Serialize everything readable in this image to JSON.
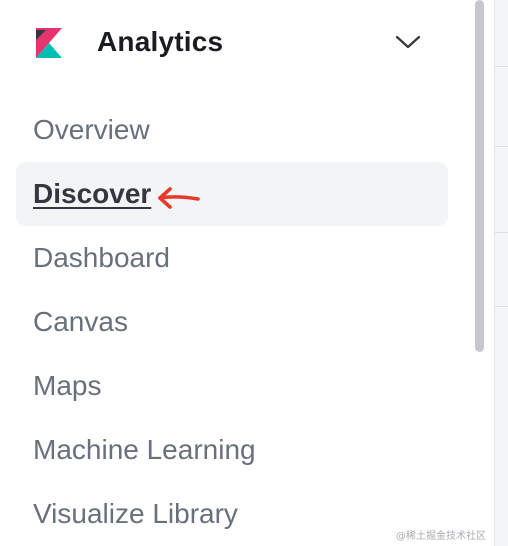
{
  "header": {
    "title": "Analytics",
    "logo_icon": "kibana-logo-icon",
    "toggle_icon": "chevron-down-icon"
  },
  "nav": {
    "items": [
      {
        "label": "Overview",
        "active": false
      },
      {
        "label": "Discover",
        "active": true
      },
      {
        "label": "Dashboard",
        "active": false
      },
      {
        "label": "Canvas",
        "active": false
      },
      {
        "label": "Maps",
        "active": false
      },
      {
        "label": "Machine Learning",
        "active": false
      },
      {
        "label": "Visualize Library",
        "active": false
      }
    ]
  },
  "annotation": {
    "icon": "red-arrow-icon",
    "color": "#e8392b"
  },
  "colors": {
    "title": "#1a1c21",
    "item_text": "#69707d",
    "active_text": "#343741",
    "active_bg": "#f3f4f6",
    "logo_pink": "#e7336e",
    "logo_teal": "#00bfb3",
    "logo_dark": "#343741"
  },
  "watermark": "@稀土掘金技术社区"
}
